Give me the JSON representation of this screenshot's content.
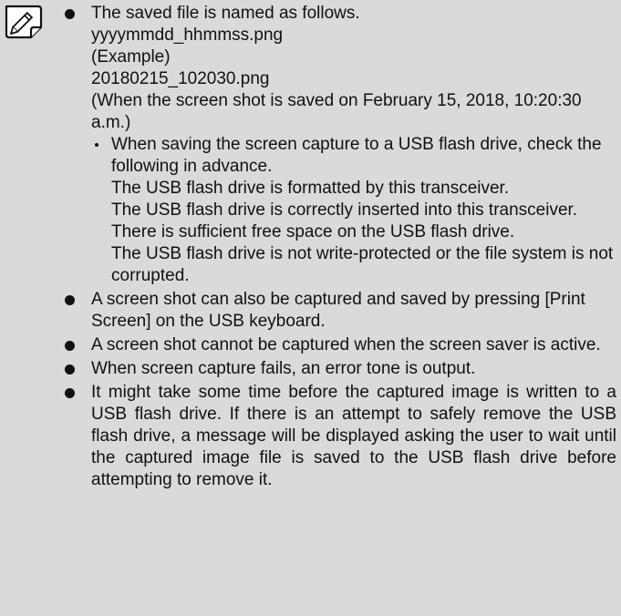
{
  "icon": "pencil-note-icon",
  "colors": {
    "background": "#dadada",
    "text": "#111111"
  },
  "notes": [
    {
      "lines": [
        "The saved file is named as follows.",
        "yyyymmdd_hhmmss.png",
        "(Example)",
        "20180215_102030.png",
        "(When the screen shot is saved on February 15, 2018, 10:20:30 a.m.)"
      ],
      "sub": {
        "lines": [
          "When saving the screen capture to a USB flash drive, check the following in advance.",
          "The USB flash drive is formatted by this transceiver.",
          "The USB flash drive is correctly inserted into this transceiver.",
          "There is sufficient free space on the USB flash drive.",
          "The USB flash drive is not write-protected or the file system is not corrupted."
        ]
      }
    },
    {
      "text": "A screen shot can also be captured and saved by pressing [Print Screen] on the USB keyboard."
    },
    {
      "text": "A screen shot cannot be captured when the screen saver is active."
    },
    {
      "text": "When screen capture fails, an error tone is output."
    },
    {
      "text": "It might take some time before the captured image is written to a USB flash drive. If there is an attempt to safely remove the USB flash drive, a message will be displayed asking the user to wait until the captured image file is saved to the USB flash drive before attempting to remove it."
    }
  ]
}
